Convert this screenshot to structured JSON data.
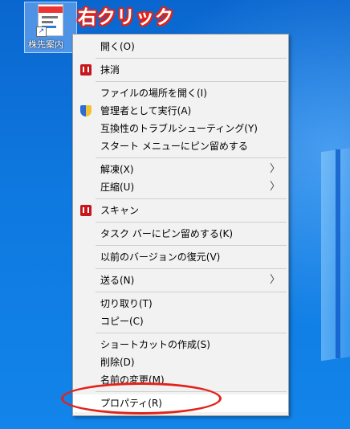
{
  "desktop_icon": {
    "label": "株先案内"
  },
  "annotation": "右クリック",
  "menu": {
    "open": "開く(O)",
    "shred": "抹消",
    "open_location": "ファイルの場所を開く(I)",
    "run_as_admin": "管理者として実行(A)",
    "troubleshoot": "互換性のトラブルシューティング(Y)",
    "pin_start": "スタート メニューにピン留めする",
    "extract": "解凍(X)",
    "compress": "圧縮(U)",
    "scan": "スキャン",
    "pin_taskbar": "タスク バーにピン留めする(K)",
    "restore_prev": "以前のバージョンの復元(V)",
    "send_to": "送る(N)",
    "cut": "切り取り(T)",
    "copy": "コピー(C)",
    "create_shortcut": "ショートカットの作成(S)",
    "delete": "削除(D)",
    "rename": "名前の変更(M)",
    "properties": "プロパティ(R)",
    "submenu_arrow": "〉"
  },
  "colors": {
    "highlight": "#e2231a",
    "desktop": "#0f6fd3"
  }
}
